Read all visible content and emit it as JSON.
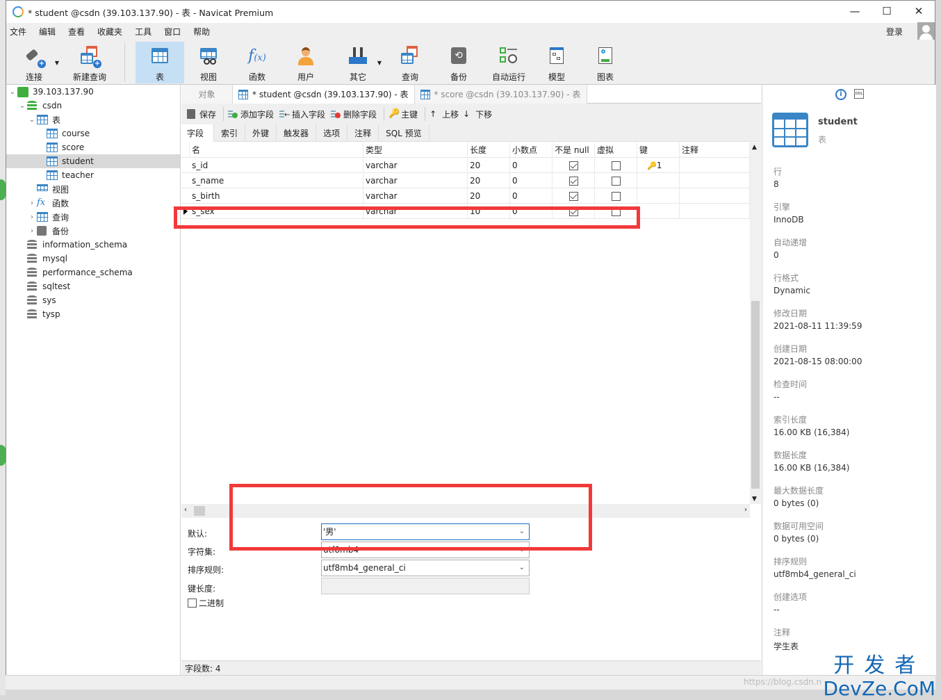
{
  "window": {
    "title": "* student @csdn (39.103.137.90) - 表 - Navicat Premium",
    "controls": [
      "—",
      "☐",
      "✕"
    ]
  },
  "menu": {
    "items": [
      "文件",
      "编辑",
      "查看",
      "收藏夹",
      "工具",
      "窗口",
      "帮助"
    ],
    "login": "登录"
  },
  "toolbar": {
    "items": [
      {
        "label": "连接",
        "icon": "connection-icon",
        "dropdown": true
      },
      {
        "label": "新建查询",
        "icon": "new-query-icon"
      },
      {
        "label": "表",
        "icon": "table-icon",
        "active": true
      },
      {
        "label": "视图",
        "icon": "view-icon"
      },
      {
        "label": "函数",
        "icon": "function-icon"
      },
      {
        "label": "用户",
        "icon": "user-icon"
      },
      {
        "label": "其它",
        "icon": "tools-icon",
        "dropdown": true
      },
      {
        "label": "查询",
        "icon": "query-icon"
      },
      {
        "label": "备份",
        "icon": "backup-icon"
      },
      {
        "label": "自动运行",
        "icon": "schedule-icon"
      },
      {
        "label": "模型",
        "icon": "model-icon"
      },
      {
        "label": "图表",
        "icon": "chart-icon"
      }
    ]
  },
  "sidebar": {
    "server": "39.103.137.90",
    "db": "csdn",
    "tables_label": "表",
    "tables": [
      "course",
      "score",
      "student",
      "teacher"
    ],
    "selected_table": "student",
    "groups": [
      "视图",
      "函数",
      "查询",
      "备份"
    ],
    "databases": [
      "information_schema",
      "mysql",
      "performance_schema",
      "sqltest",
      "sys",
      "tysp"
    ]
  },
  "tabs": {
    "objects": "对象",
    "items": [
      "* student @csdn (39.103.137.90) - 表",
      "* score @csdn (39.103.137.90) - 表"
    ]
  },
  "designer_toolbar": {
    "save": "保存",
    "add_field": "添加字段",
    "insert_field": "插入字段",
    "delete_field": "删除字段",
    "primary_key": "主键",
    "move_up": "上移",
    "move_down": "下移"
  },
  "subtabs": [
    "字段",
    "索引",
    "外键",
    "触发器",
    "选项",
    "注释",
    "SQL 预览"
  ],
  "grid": {
    "columns": [
      "名",
      "类型",
      "长度",
      "小数点",
      "不是 null",
      "虚拟",
      "键",
      "注释"
    ],
    "rows": [
      {
        "name": "s_id",
        "type": "varchar",
        "length": "20",
        "decimals": "0",
        "not_null": true,
        "virtual": false,
        "key": "1",
        "comment": ""
      },
      {
        "name": "s_name",
        "type": "varchar",
        "length": "20",
        "decimals": "0",
        "not_null": true,
        "virtual": false,
        "key": "",
        "comment": ""
      },
      {
        "name": "s_birth",
        "type": "varchar",
        "length": "20",
        "decimals": "0",
        "not_null": true,
        "virtual": false,
        "key": "",
        "comment": ""
      },
      {
        "name": "s_sex",
        "type": "varchar",
        "length": "10",
        "decimals": "0",
        "not_null": true,
        "virtual": false,
        "key": "",
        "comment": ""
      }
    ],
    "current_row": 3
  },
  "props": {
    "default_label": "默认:",
    "default_value": "'男'",
    "charset_label": "字符集:",
    "charset_value": "utf8mb4",
    "collation_label": "排序规则:",
    "collation_value": "utf8mb4_general_ci",
    "keylen_label": "键长度:",
    "keylen_value": "",
    "binary_label": "二进制",
    "binary_checked": false
  },
  "status": {
    "field_count": "字段数: 4"
  },
  "info": {
    "name": "student",
    "type": "表",
    "fields": [
      {
        "label": "行",
        "value": "8"
      },
      {
        "label": "引擎",
        "value": "InnoDB"
      },
      {
        "label": "自动递增",
        "value": "0"
      },
      {
        "label": "行格式",
        "value": "Dynamic"
      },
      {
        "label": "修改日期",
        "value": "2021-08-11 11:39:59"
      },
      {
        "label": "创建日期",
        "value": "2021-08-15 08:00:00"
      },
      {
        "label": "检查时间",
        "value": "--"
      },
      {
        "label": "索引长度",
        "value": "16.00 KB (16,384)"
      },
      {
        "label": "数据长度",
        "value": "16.00 KB (16,384)"
      },
      {
        "label": "最大数据长度",
        "value": "0 bytes (0)"
      },
      {
        "label": "数据可用空间",
        "value": "0 bytes (0)"
      },
      {
        "label": "排序规则",
        "value": "utf8mb4_general_ci"
      },
      {
        "label": "创建选项",
        "value": "--"
      },
      {
        "label": "注释",
        "value": "学生表"
      }
    ]
  },
  "watermark": {
    "line1": "开发者",
    "line2": "DevZe.CoM",
    "url": "https://blog.csdn.n"
  },
  "colors": {
    "accent": "#3a85c6",
    "highlight": "#f2393a",
    "active_tool": "#c5dff5"
  }
}
